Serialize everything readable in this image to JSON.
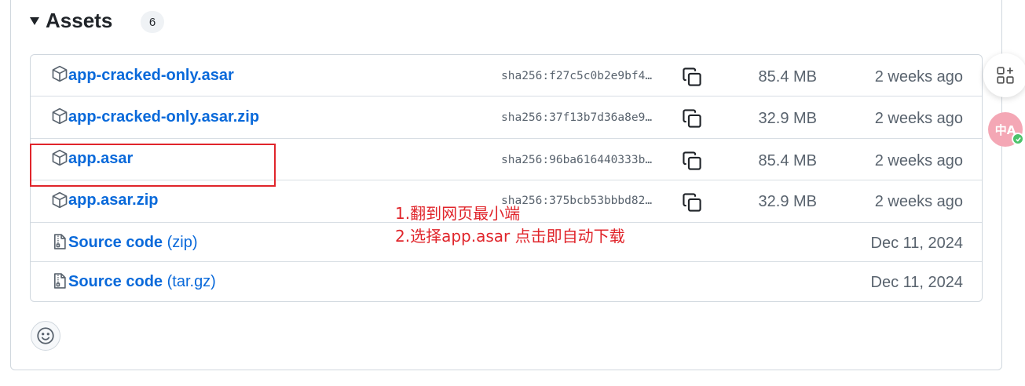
{
  "assets": {
    "title": "Assets",
    "count": "6",
    "rows": [
      {
        "name": "app-cracked-only.asar",
        "sha": "sha256:f27c5c0b2e9bf4…",
        "size": "85.4 MB",
        "date": "2 weeks ago",
        "icon": "package-icon"
      },
      {
        "name": "app-cracked-only.asar.zip",
        "sha": "sha256:37f13b7d36a8e9…",
        "size": "32.9 MB",
        "date": "2 weeks ago",
        "icon": "package-icon"
      },
      {
        "name": "app.asar",
        "sha": "sha256:96ba616440333b…",
        "size": "85.4 MB",
        "date": "2 weeks ago",
        "icon": "package-icon"
      },
      {
        "name": "app.asar.zip",
        "sha": "sha256:375bcb53bbbd82…",
        "size": "32.9 MB",
        "date": "2 weeks ago",
        "icon": "package-icon"
      },
      {
        "name": "Source code",
        "suffix": "(zip)",
        "date": "Dec 11, 2024",
        "icon": "file-zip-icon"
      },
      {
        "name": "Source code",
        "suffix": "(tar.gz)",
        "date": "Dec 11, 2024",
        "icon": "file-zip-icon"
      }
    ]
  },
  "annotation": {
    "line1": "1.翻到网页最小端",
    "line2": "2.选择app.asar 点击即自动下载"
  },
  "side": {
    "translate_label": "中A"
  },
  "colors": {
    "link": "#0969da",
    "muted": "#59636e",
    "annotation": "#e0252b",
    "border": "#d0d7de"
  }
}
